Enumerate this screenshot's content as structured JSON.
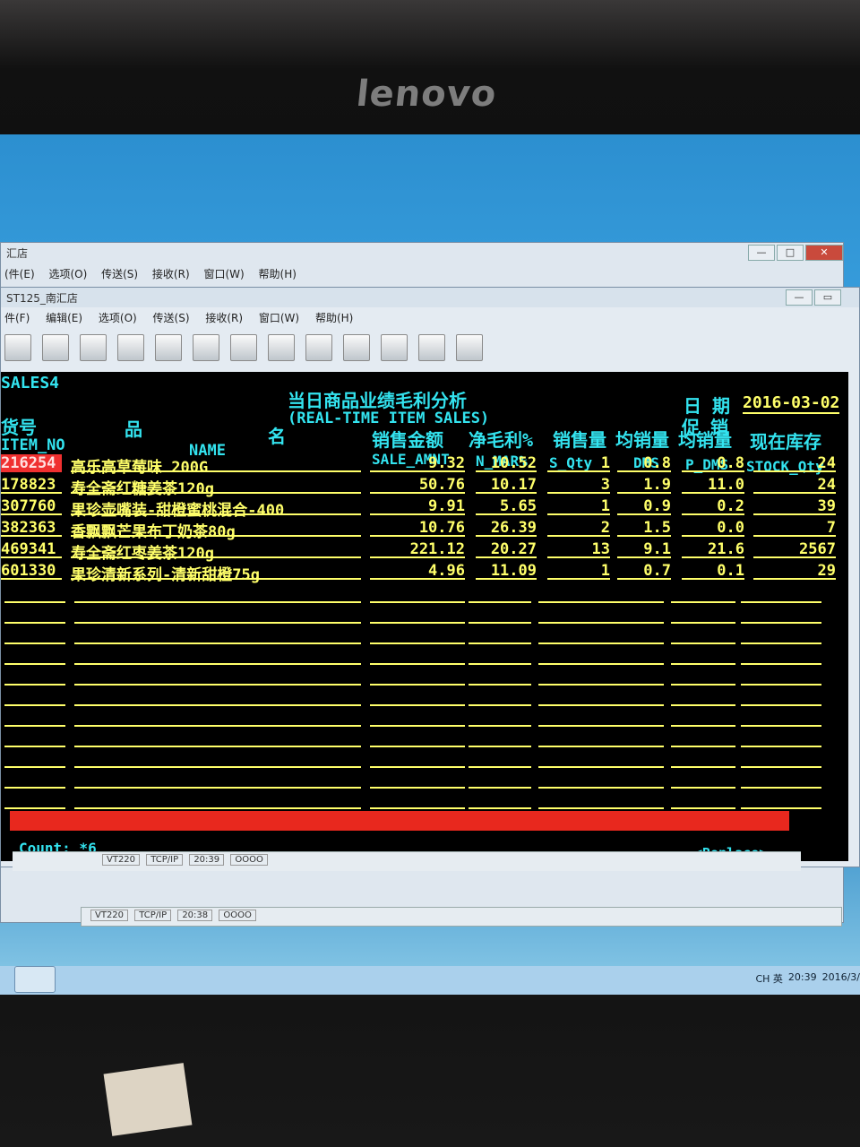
{
  "monitor": {
    "brand": "lenovo"
  },
  "back_window": {
    "title": "汇店",
    "menu": [
      "(件(E)",
      "选项(O)",
      "传送(S)",
      "接收(R)",
      "窗口(W)",
      "帮助(H)"
    ],
    "status": {
      "protocol": "VT220",
      "conn": "TCP/IP",
      "time": "20:38",
      "leds": "OOOO"
    }
  },
  "front_window": {
    "title": "ST125_南汇店",
    "menu": [
      "件(F)",
      "编辑(E)",
      "选项(O)",
      "传送(S)",
      "接收(R)",
      "窗口(W)",
      "帮助(H)"
    ],
    "status": {
      "protocol": "VT220",
      "conn": "TCP/IP",
      "time": "20:39",
      "leds": "OOOO"
    }
  },
  "terminal": {
    "screen_id": "SALES4",
    "title_cn": "当日商品业绩毛利分析",
    "title_en": "(REAL-TIME ITEM SALES)",
    "date_label": "日 期",
    "date_value": "2016-03-02",
    "promo_label": "促 销",
    "headers_cn": {
      "item_no": "货号",
      "name_a": "品",
      "name_b": "名",
      "sale": "销售金额",
      "margin": "净毛利%",
      "qty": "销售量",
      "dms": "均销量",
      "pdms": "均销量",
      "stock": "现在库存"
    },
    "headers_en": {
      "item_no": "ITEM_NO",
      "name": "NAME",
      "sale": "SALE_AMNT",
      "margin": "N_MAR%",
      "qty": "S_Qty",
      "dms": "DMS",
      "pdms": "P_DMS",
      "stock": "STOCK_Qty"
    },
    "rows": [
      {
        "item_no": "216254",
        "name": "高乐高草莓味 200G",
        "sale": "9.32",
        "margin": "10.52",
        "qty": "1",
        "dms": "0.8",
        "pdms": "0.8",
        "stock": "24"
      },
      {
        "item_no": "178823",
        "name": "寿全斋红糖姜茶120g",
        "sale": "50.76",
        "margin": "10.17",
        "qty": "3",
        "dms": "1.9",
        "pdms": "11.0",
        "stock": "24"
      },
      {
        "item_no": "307760",
        "name": "果珍壶嘴装-甜橙蜜桃混合-400",
        "sale": "9.91",
        "margin": "5.65",
        "qty": "1",
        "dms": "0.9",
        "pdms": "0.2",
        "stock": "39"
      },
      {
        "item_no": "382363",
        "name": "香飘飘芒果布丁奶茶80g",
        "sale": "10.76",
        "margin": "26.39",
        "qty": "2",
        "dms": "1.5",
        "pdms": "0.0",
        "stock": "7"
      },
      {
        "item_no": "469341",
        "name": "寿全斋红枣姜茶120g",
        "sale": "221.12",
        "margin": "20.27",
        "qty": "13",
        "dms": "9.1",
        "pdms": "21.6",
        "stock": "2567"
      },
      {
        "item_no": "601330",
        "name": "果珍清新系列-清新甜橙75g",
        "sale": "4.96",
        "margin": "11.09",
        "qty": "1",
        "dms": "0.7",
        "pdms": "0.1",
        "stock": "29"
      }
    ],
    "count_label": "Count: *6",
    "mode": "<Replace>"
  },
  "taskbar": {
    "tray_text": "CH 英",
    "clock_time": "20:39",
    "clock_date": "2016/3/"
  },
  "colors": {
    "terminal_bg": "#000000",
    "cyan_text": "#33e3ef",
    "yellow_text": "#ffff6a",
    "highlight": "#f03030"
  }
}
